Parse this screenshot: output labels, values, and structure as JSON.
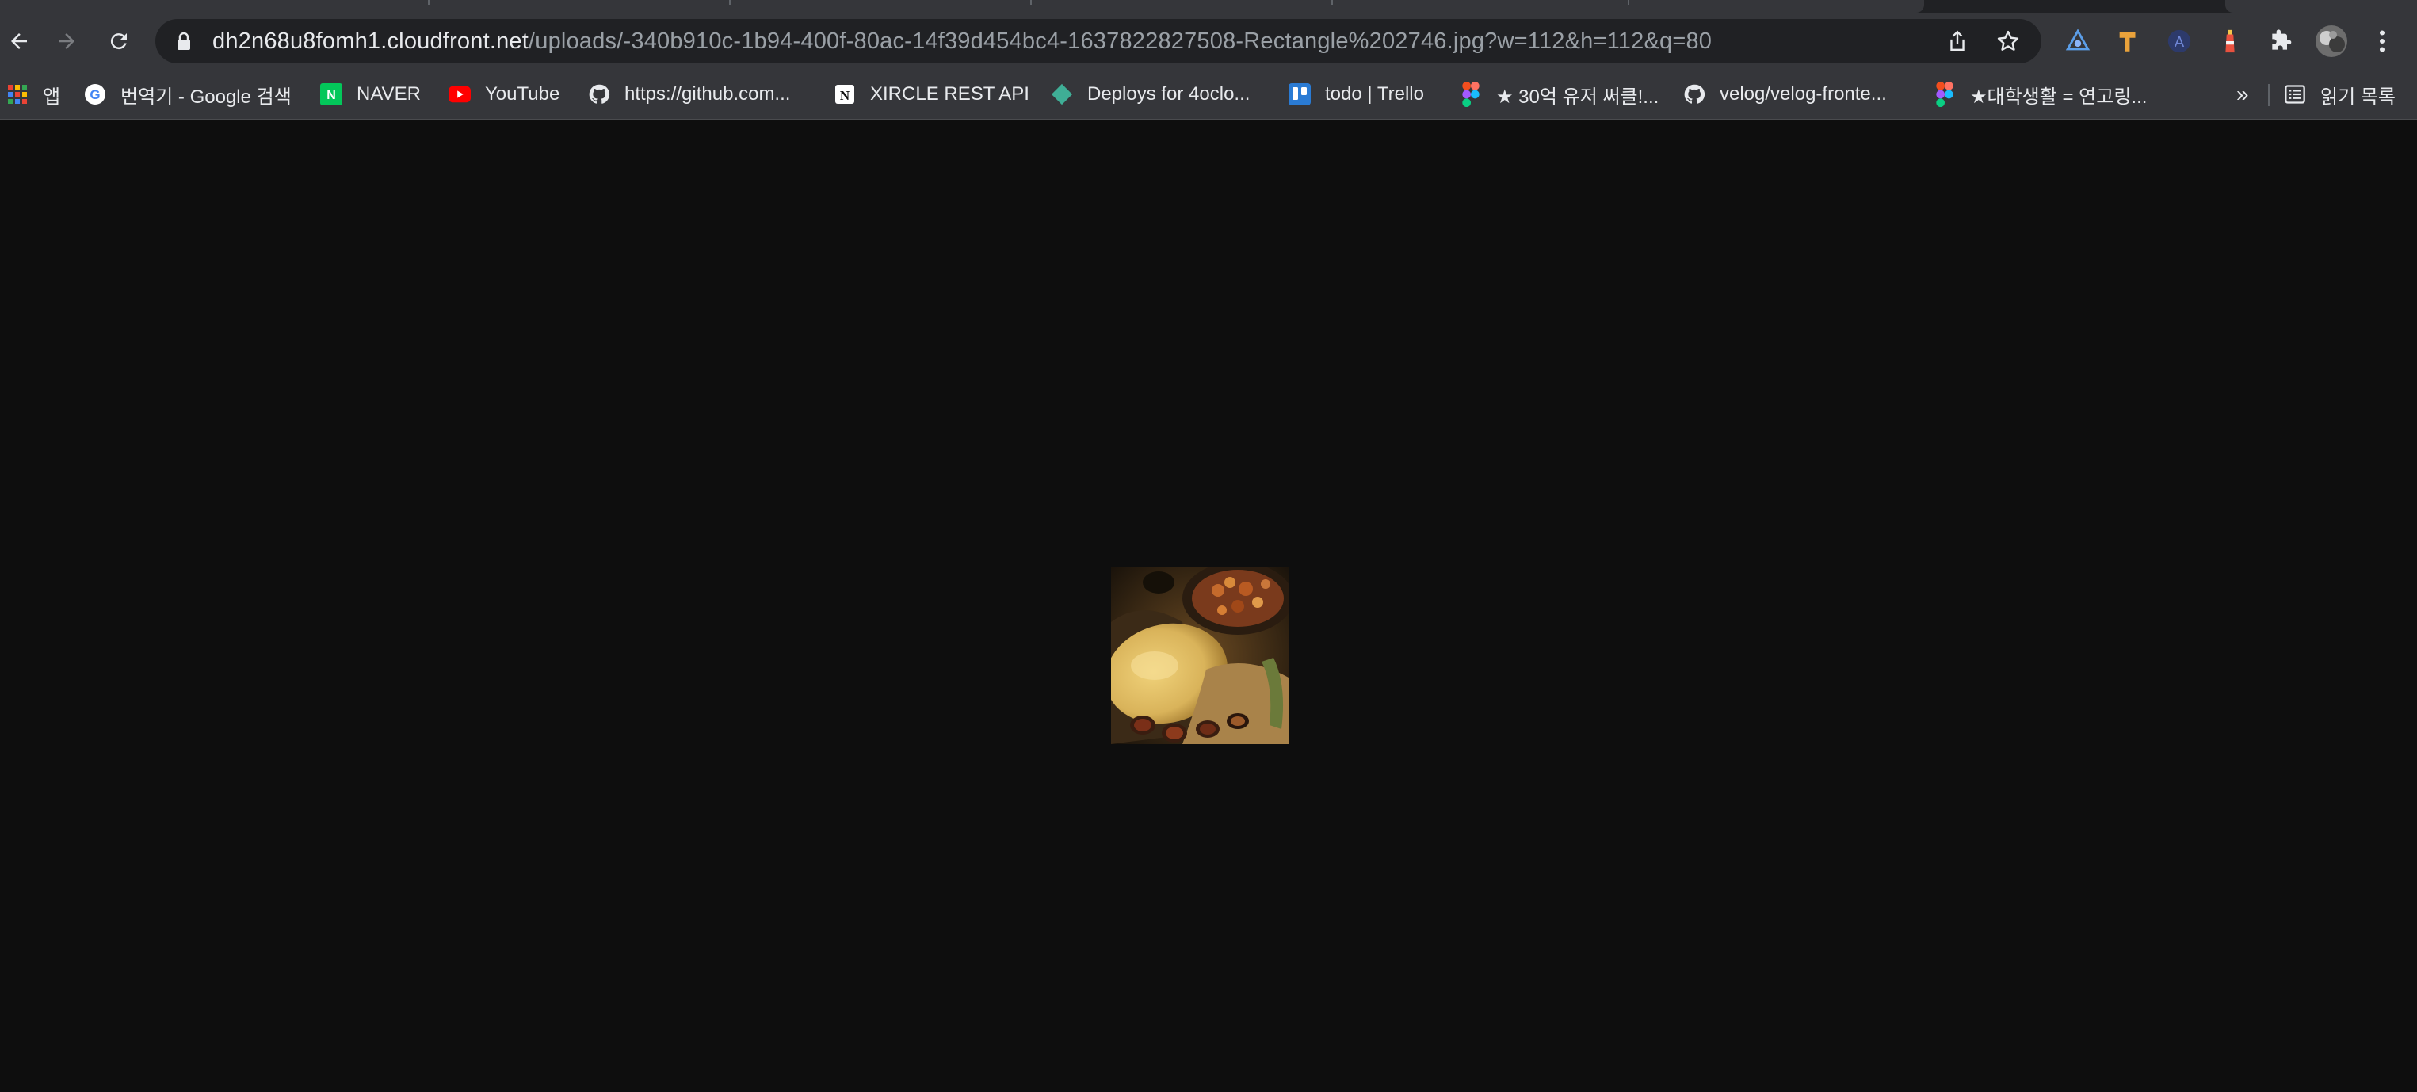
{
  "browser": {
    "url_host": "dh2n68u8fomh1.cloudfront.net",
    "url_path": "/uploads/-340b910c-1b94-400f-80ac-14f39d454bc4-1637822827508-Rectangle%202746.jpg?w=112&h=112&q=80"
  },
  "bookmarks": [
    {
      "label": "앱",
      "icon": "apps-grid-icon"
    },
    {
      "label": "번역기 - Google 검색",
      "icon": "google-icon"
    },
    {
      "label": "NAVER",
      "icon": "naver-icon"
    },
    {
      "label": "YouTube",
      "icon": "youtube-icon"
    },
    {
      "label": "https://github.com...",
      "icon": "github-icon"
    },
    {
      "label": "XIRCLE REST API",
      "icon": "notion-icon"
    },
    {
      "label": "Deploys for 4oclo...",
      "icon": "netlify-icon"
    },
    {
      "label": "todo | Trello",
      "icon": "trello-icon"
    },
    {
      "label": "★ 30억 유저 써클!...",
      "icon": "figma-icon"
    },
    {
      "label": "velog/velog-fronte...",
      "icon": "github-icon"
    },
    {
      "label": "★대학생활 = 연고링...",
      "icon": "figma-icon"
    }
  ],
  "reading_list": {
    "label": "읽기 목록",
    "icon": "reading-list-icon"
  },
  "overflow_label": "»",
  "colors": {
    "toolbar": "#35363a",
    "omnibox": "#202124",
    "page_background": "#0e0e0e"
  }
}
